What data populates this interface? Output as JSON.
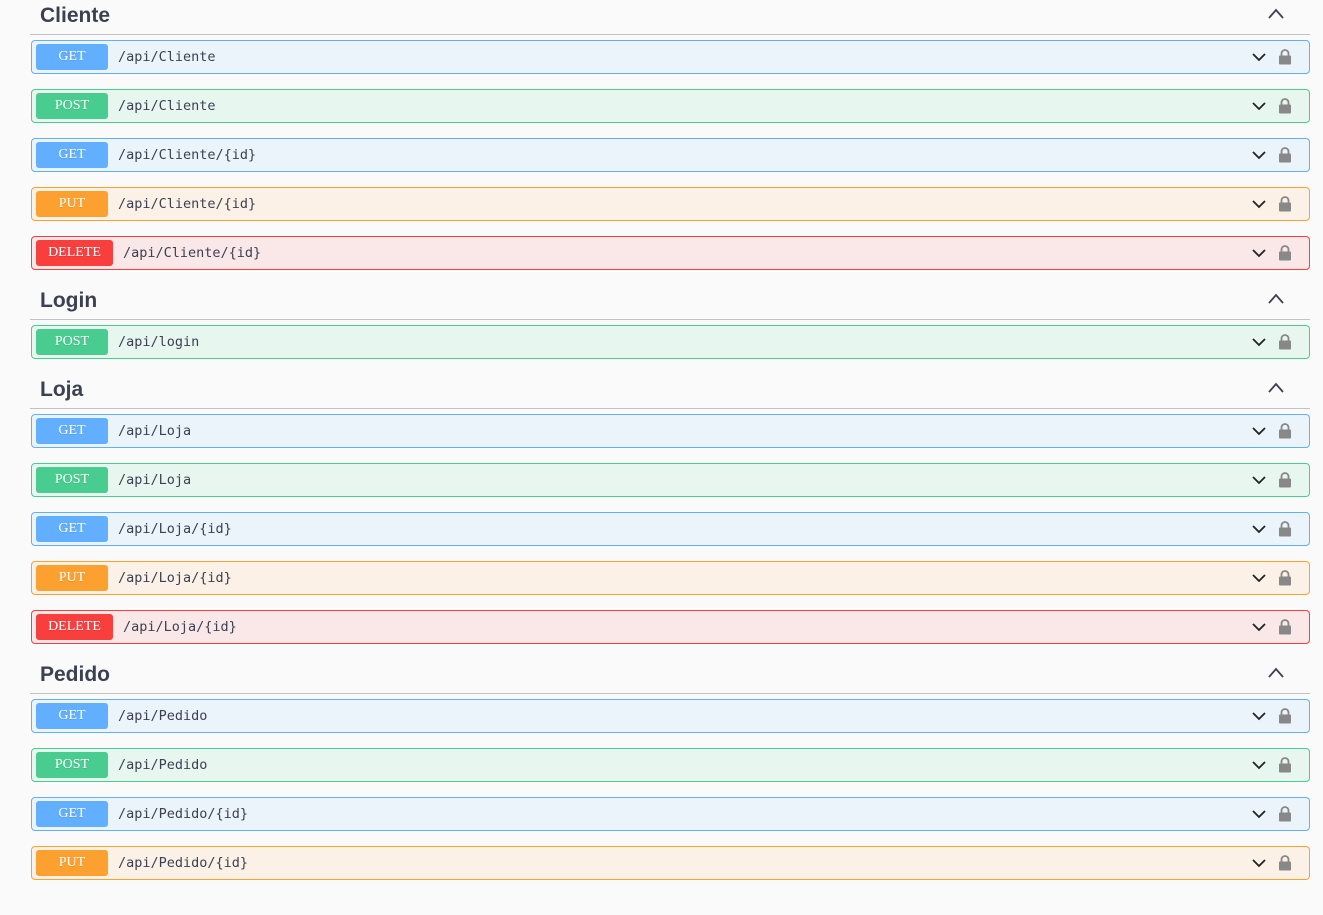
{
  "colors": {
    "get": "#61affe",
    "post": "#49cc90",
    "put": "#fca130",
    "delete": "#f93e3e",
    "title": "#3b4151"
  },
  "sections": [
    {
      "title": "Cliente",
      "ops": [
        {
          "method": "GET",
          "path": "/api/Cliente"
        },
        {
          "method": "POST",
          "path": "/api/Cliente"
        },
        {
          "method": "GET",
          "path": "/api/Cliente/{id}"
        },
        {
          "method": "PUT",
          "path": "/api/Cliente/{id}"
        },
        {
          "method": "DELETE",
          "path": "/api/Cliente/{id}"
        }
      ]
    },
    {
      "title": "Login",
      "ops": [
        {
          "method": "POST",
          "path": "/api/login"
        }
      ]
    },
    {
      "title": "Loja",
      "ops": [
        {
          "method": "GET",
          "path": "/api/Loja"
        },
        {
          "method": "POST",
          "path": "/api/Loja"
        },
        {
          "method": "GET",
          "path": "/api/Loja/{id}"
        },
        {
          "method": "PUT",
          "path": "/api/Loja/{id}"
        },
        {
          "method": "DELETE",
          "path": "/api/Loja/{id}"
        }
      ]
    },
    {
      "title": "Pedido",
      "ops": [
        {
          "method": "GET",
          "path": "/api/Pedido"
        },
        {
          "method": "POST",
          "path": "/api/Pedido"
        },
        {
          "method": "GET",
          "path": "/api/Pedido/{id}"
        },
        {
          "method": "PUT",
          "path": "/api/Pedido/{id}"
        }
      ]
    }
  ],
  "icons": {
    "section_toggle": "chevron-up-icon",
    "op_toggle": "chevron-down-icon",
    "auth": "lock-icon"
  }
}
